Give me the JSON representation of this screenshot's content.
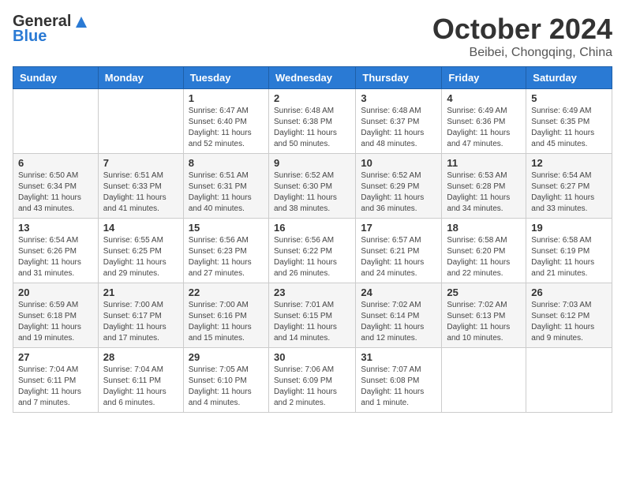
{
  "header": {
    "logo_general": "General",
    "logo_blue": "Blue",
    "month_title": "October 2024",
    "location": "Beibei, Chongqing, China"
  },
  "days_of_week": [
    "Sunday",
    "Monday",
    "Tuesday",
    "Wednesday",
    "Thursday",
    "Friday",
    "Saturday"
  ],
  "weeks": [
    [
      {
        "day": "",
        "info": ""
      },
      {
        "day": "",
        "info": ""
      },
      {
        "day": "1",
        "sunrise": "6:47 AM",
        "sunset": "6:40 PM",
        "daylight": "11 hours and 52 minutes."
      },
      {
        "day": "2",
        "sunrise": "6:48 AM",
        "sunset": "6:38 PM",
        "daylight": "11 hours and 50 minutes."
      },
      {
        "day": "3",
        "sunrise": "6:48 AM",
        "sunset": "6:37 PM",
        "daylight": "11 hours and 48 minutes."
      },
      {
        "day": "4",
        "sunrise": "6:49 AM",
        "sunset": "6:36 PM",
        "daylight": "11 hours and 47 minutes."
      },
      {
        "day": "5",
        "sunrise": "6:49 AM",
        "sunset": "6:35 PM",
        "daylight": "11 hours and 45 minutes."
      }
    ],
    [
      {
        "day": "6",
        "sunrise": "6:50 AM",
        "sunset": "6:34 PM",
        "daylight": "11 hours and 43 minutes."
      },
      {
        "day": "7",
        "sunrise": "6:51 AM",
        "sunset": "6:33 PM",
        "daylight": "11 hours and 41 minutes."
      },
      {
        "day": "8",
        "sunrise": "6:51 AM",
        "sunset": "6:31 PM",
        "daylight": "11 hours and 40 minutes."
      },
      {
        "day": "9",
        "sunrise": "6:52 AM",
        "sunset": "6:30 PM",
        "daylight": "11 hours and 38 minutes."
      },
      {
        "day": "10",
        "sunrise": "6:52 AM",
        "sunset": "6:29 PM",
        "daylight": "11 hours and 36 minutes."
      },
      {
        "day": "11",
        "sunrise": "6:53 AM",
        "sunset": "6:28 PM",
        "daylight": "11 hours and 34 minutes."
      },
      {
        "day": "12",
        "sunrise": "6:54 AM",
        "sunset": "6:27 PM",
        "daylight": "11 hours and 33 minutes."
      }
    ],
    [
      {
        "day": "13",
        "sunrise": "6:54 AM",
        "sunset": "6:26 PM",
        "daylight": "11 hours and 31 minutes."
      },
      {
        "day": "14",
        "sunrise": "6:55 AM",
        "sunset": "6:25 PM",
        "daylight": "11 hours and 29 minutes."
      },
      {
        "day": "15",
        "sunrise": "6:56 AM",
        "sunset": "6:23 PM",
        "daylight": "11 hours and 27 minutes."
      },
      {
        "day": "16",
        "sunrise": "6:56 AM",
        "sunset": "6:22 PM",
        "daylight": "11 hours and 26 minutes."
      },
      {
        "day": "17",
        "sunrise": "6:57 AM",
        "sunset": "6:21 PM",
        "daylight": "11 hours and 24 minutes."
      },
      {
        "day": "18",
        "sunrise": "6:58 AM",
        "sunset": "6:20 PM",
        "daylight": "11 hours and 22 minutes."
      },
      {
        "day": "19",
        "sunrise": "6:58 AM",
        "sunset": "6:19 PM",
        "daylight": "11 hours and 21 minutes."
      }
    ],
    [
      {
        "day": "20",
        "sunrise": "6:59 AM",
        "sunset": "6:18 PM",
        "daylight": "11 hours and 19 minutes."
      },
      {
        "day": "21",
        "sunrise": "7:00 AM",
        "sunset": "6:17 PM",
        "daylight": "11 hours and 17 minutes."
      },
      {
        "day": "22",
        "sunrise": "7:00 AM",
        "sunset": "6:16 PM",
        "daylight": "11 hours and 15 minutes."
      },
      {
        "day": "23",
        "sunrise": "7:01 AM",
        "sunset": "6:15 PM",
        "daylight": "11 hours and 14 minutes."
      },
      {
        "day": "24",
        "sunrise": "7:02 AM",
        "sunset": "6:14 PM",
        "daylight": "11 hours and 12 minutes."
      },
      {
        "day": "25",
        "sunrise": "7:02 AM",
        "sunset": "6:13 PM",
        "daylight": "11 hours and 10 minutes."
      },
      {
        "day": "26",
        "sunrise": "7:03 AM",
        "sunset": "6:12 PM",
        "daylight": "11 hours and 9 minutes."
      }
    ],
    [
      {
        "day": "27",
        "sunrise": "7:04 AM",
        "sunset": "6:11 PM",
        "daylight": "11 hours and 7 minutes."
      },
      {
        "day": "28",
        "sunrise": "7:04 AM",
        "sunset": "6:11 PM",
        "daylight": "11 hours and 6 minutes."
      },
      {
        "day": "29",
        "sunrise": "7:05 AM",
        "sunset": "6:10 PM",
        "daylight": "11 hours and 4 minutes."
      },
      {
        "day": "30",
        "sunrise": "7:06 AM",
        "sunset": "6:09 PM",
        "daylight": "11 hours and 2 minutes."
      },
      {
        "day": "31",
        "sunrise": "7:07 AM",
        "sunset": "6:08 PM",
        "daylight": "11 hours and 1 minute."
      },
      {
        "day": "",
        "info": ""
      },
      {
        "day": "",
        "info": ""
      }
    ]
  ]
}
